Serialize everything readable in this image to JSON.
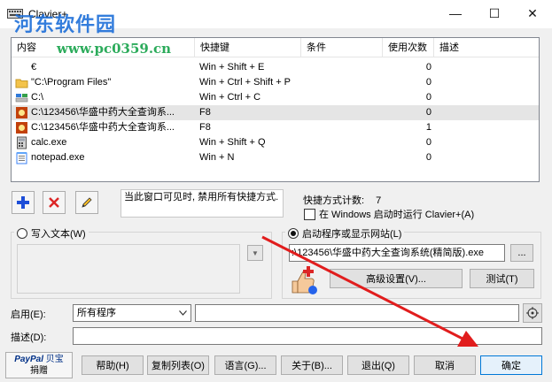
{
  "window": {
    "title": "Clavier+",
    "minimize": "—",
    "maximize": "☐",
    "close": "✕"
  },
  "watermark": {
    "text": "河东软件园",
    "url": "www.pc0359.cn"
  },
  "list": {
    "columns": [
      "内容",
      "快捷键",
      "条件",
      "使用次数",
      "描述"
    ],
    "rows": [
      {
        "icon": "euro-icon",
        "content": "€",
        "hotkey": "Win + Shift + E",
        "count": "0"
      },
      {
        "icon": "folder-icon",
        "content": "\"C:\\Program Files\"",
        "hotkey": "Win + Ctrl + Shift + P",
        "count": "0"
      },
      {
        "icon": "drive-icon",
        "content": "C:\\",
        "hotkey": "Win + Ctrl + C",
        "count": "0"
      },
      {
        "icon": "app-icon",
        "content": "C:\\123456\\华盛中药大全查询系...",
        "hotkey": "F8",
        "count": "0"
      },
      {
        "icon": "app-icon",
        "content": "C:\\123456\\华盛中药大全查询系...",
        "hotkey": "F8",
        "count": "1"
      },
      {
        "icon": "calculator-icon",
        "content": "calc.exe",
        "hotkey": "Win + Shift + Q",
        "count": "0"
      },
      {
        "icon": "notepad-icon",
        "content": "notepad.exe",
        "hotkey": "Win + N",
        "count": "0"
      }
    ]
  },
  "status": {
    "text": "当此窗口可见时, 禁用所有快捷方式."
  },
  "hotkey_count": {
    "label": "快捷方式计数:",
    "value": "7"
  },
  "startup": {
    "label": "在 Windows 启动时运行 Clavier+(A)"
  },
  "write_text": {
    "label": "写入文本(W)"
  },
  "launch": {
    "label": "启动程序或显示网站(L)",
    "path": ":\\123456\\华盛中药大全查询系统(精简版).exe",
    "browse": "...",
    "advanced": "高级设置(V)...",
    "test": "测试(T)"
  },
  "enable": {
    "label": "启用(E):",
    "selected": "所有程序"
  },
  "description": {
    "label": "描述(D):"
  },
  "paypal": {
    "logo_pay": "PayPal",
    "logo_cn": "贝宝",
    "donate": "捐赠"
  },
  "buttons": {
    "help": "帮助(H)",
    "copy_list": "复制列表(O)",
    "language": "语言(G)...",
    "about": "关于(B)...",
    "exit": "退出(Q)",
    "cancel": "取消",
    "ok": "确定"
  },
  "colors": {
    "accent": "#0078d7",
    "arrow": "#e11d1d",
    "selected_row": "#e5e5e5"
  }
}
